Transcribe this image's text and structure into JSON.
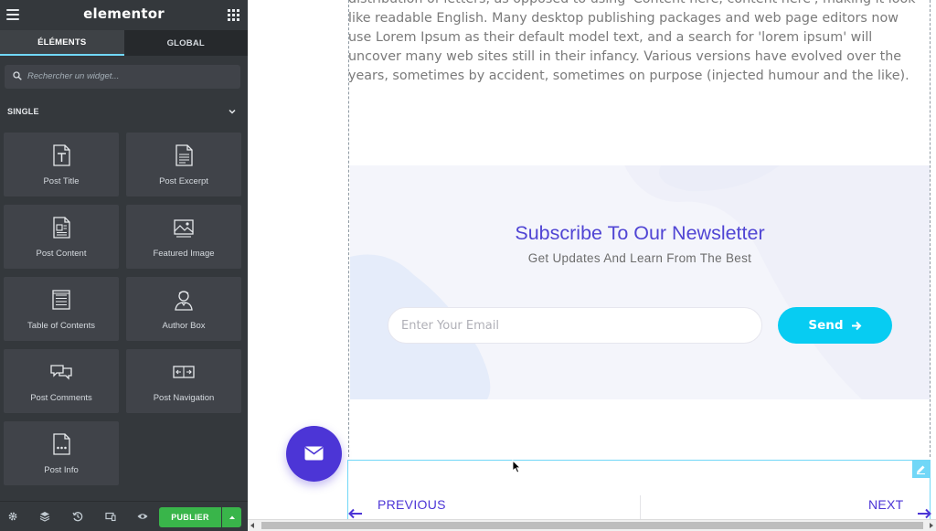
{
  "editor": {
    "logo": "elementor",
    "tabs": [
      {
        "label": "ÉLÉMENTS",
        "active": true
      },
      {
        "label": "GLOBAL",
        "active": false
      }
    ],
    "search_placeholder": "Rechercher un widget...",
    "category": "SINGLE",
    "widgets": [
      {
        "label": "Post Title",
        "icon": "post-title-icon"
      },
      {
        "label": "Post Excerpt",
        "icon": "post-excerpt-icon"
      },
      {
        "label": "Post Content",
        "icon": "post-content-icon"
      },
      {
        "label": "Featured Image",
        "icon": "featured-image-icon"
      },
      {
        "label": "Table of Contents",
        "icon": "table-of-contents-icon"
      },
      {
        "label": "Author Box",
        "icon": "author-box-icon"
      },
      {
        "label": "Post Comments",
        "icon": "post-comments-icon"
      },
      {
        "label": "Post Navigation",
        "icon": "post-navigation-icon"
      },
      {
        "label": "Post Info",
        "icon": "post-info-icon"
      }
    ],
    "footer": {
      "publish_label": "PUBLIER",
      "icons": [
        "settings-icon",
        "navigator-icon",
        "history-icon",
        "responsive-icon",
        "preview-icon"
      ]
    }
  },
  "page": {
    "body_text": "distribution of letters, as opposed to using 'Content here, content here', making it look like readable English. Many desktop publishing packages and web page editors now use Lorem Ipsum as their default model text, and a search for 'lorem ipsum' will uncover many web sites still in their infancy. Various versions have evolved over the years, sometimes by accident, sometimes on purpose (injected humour and the like).",
    "newsletter": {
      "title": "Subscribe To Our Newsletter",
      "subtitle": "Get Updates And Learn From The Best",
      "email_placeholder": "Enter Your Email",
      "send_label": "Send"
    },
    "post_nav": {
      "previous": "PREVIOUS",
      "next": "NEXT"
    }
  },
  "colors": {
    "sidebar_bg": "#34383c",
    "accent_blue": "#71d7f7",
    "publish_green": "#39b54a",
    "brand_purple": "#4c35d6",
    "send_cyan": "#07ccf2"
  }
}
